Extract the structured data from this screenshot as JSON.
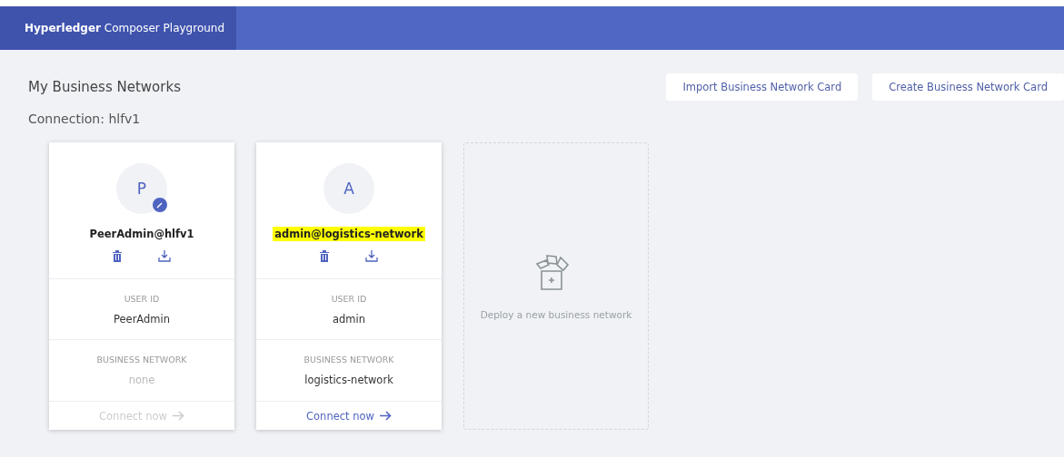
{
  "header": {
    "brand_bold": "Hyperledger",
    "brand_rest": "Composer Playground"
  },
  "title": "My Business Networks",
  "buttons": [
    "Import Business Network Card",
    "Create Business Network Card"
  ],
  "connection": "Connection: hlfv1",
  "cards": [
    {
      "initial": "P",
      "badge": true,
      "name": "PeerAdmin@hlfv1",
      "highlighted": false,
      "user_id_label": "USER ID",
      "user_id": "PeerAdmin",
      "network_label": "BUSINESS NETWORK",
      "network": "none",
      "connect": "Connect now",
      "disabled": true
    },
    {
      "initial": "A",
      "badge": false,
      "name": "admin@logistics-network",
      "highlighted": true,
      "user_id_label": "USER ID",
      "user_id": "admin",
      "network_label": "BUSINESS NETWORK",
      "network": "logistics-network",
      "connect": "Connect now",
      "disabled": false
    }
  ],
  "deploy": {
    "label": "Deploy a new business network"
  }
}
